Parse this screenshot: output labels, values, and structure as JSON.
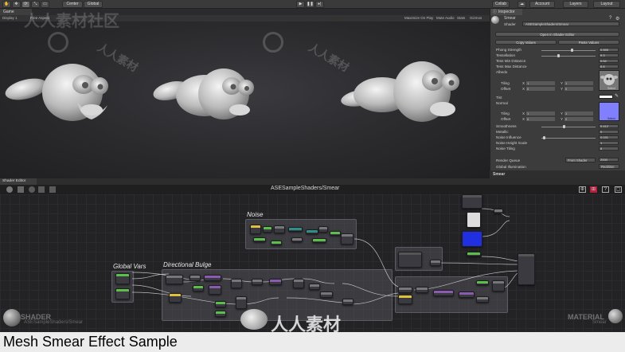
{
  "toolbar": {
    "transform_tools": [
      "✋",
      "✥",
      "⟳",
      "⤡",
      "▭"
    ],
    "center_label": "Center",
    "global_label": "Global",
    "collab_label": "Collab",
    "account_label": "Account",
    "layers_label": "Layers",
    "layout_label": "Layout"
  },
  "game_view": {
    "tab_label": "Game",
    "display_label": "Display 1",
    "aspect_label": "Free Aspect",
    "maximize_label": "Maximize On Play",
    "mute_label": "Mute Audio",
    "stats_label": "Stats",
    "gizmos_label": "Gizmos"
  },
  "inspector": {
    "tab_label": "Inspector",
    "material_name": "Smear",
    "shader_label": "Shader",
    "shader_value": "ASESampleShaders/Smear",
    "open_editor_label": "Open in Shader Editor",
    "copy_values_label": "Copy Values",
    "paste_values_label": "Paste Values",
    "properties": [
      {
        "label": "Phong Strength",
        "value": "0.555",
        "fraction": 0.56
      },
      {
        "label": "Tessellation",
        "value": "9.3",
        "fraction": 0.3
      },
      {
        "label": "Tess Min Distance",
        "value": "0.54",
        "fraction": null
      },
      {
        "label": "Tess Max Distance",
        "value": "8.8",
        "fraction": null
      },
      {
        "label": "Albedo",
        "value": "",
        "fraction": null
      }
    ],
    "albedo_tiling": {
      "label": "Tiling",
      "x": "1",
      "y": "1"
    },
    "albedo_offset": {
      "label": "Offset",
      "x": "0",
      "y": "0"
    },
    "tint_label": "Tint",
    "normal_label": "Normal",
    "normal_tiling": {
      "label": "Tiling",
      "x": "1",
      "y": "1"
    },
    "normal_offset": {
      "label": "Offset",
      "x": "0",
      "y": "0"
    },
    "texture_select_label": "Select",
    "properties2": [
      {
        "label": "Smoothness",
        "value": "0.412",
        "fraction": 0.41
      },
      {
        "label": "Metallic",
        "value": "0",
        "fraction": null
      },
      {
        "label": "Noise Influence",
        "value": "0.031",
        "fraction": 0.03
      },
      {
        "label": "Noise Height Scale",
        "value": "1",
        "fraction": null
      },
      {
        "label": "Noise Tiling",
        "value": "8",
        "fraction": null
      }
    ],
    "render_queue_label": "Render Queue",
    "render_queue_mode": "From Shader",
    "render_queue_value": "2000",
    "gi_label": "Global Illumination",
    "gi_value": "Realtime",
    "footer_label": "Smear",
    "tint_color": "#ffffff",
    "normal_color": "#8080ff"
  },
  "shader_editor": {
    "tab_label": "Shader Editor",
    "graph_title": "ASESampleShaders/Smear",
    "groups": [
      "Noise",
      "Global Vars",
      "Directional Bulge"
    ],
    "shader_badge": "SHADER",
    "shader_badge_path": "ASESampleShaders/Smear",
    "material_badge": "MATERIAL",
    "material_badge_name": "Smear"
  },
  "watermark": {
    "text": "人人素材社区",
    "center_text": "人人素材",
    "small_text": "人人素材"
  },
  "caption": "Mesh Smear Effect Sample",
  "colors": {
    "node_yellow": "#e0c23a",
    "node_green": "#5cbf4c",
    "node_purple": "#8a5bb0",
    "node_teal": "#2f8f86",
    "wire": "#d9d9d9"
  }
}
